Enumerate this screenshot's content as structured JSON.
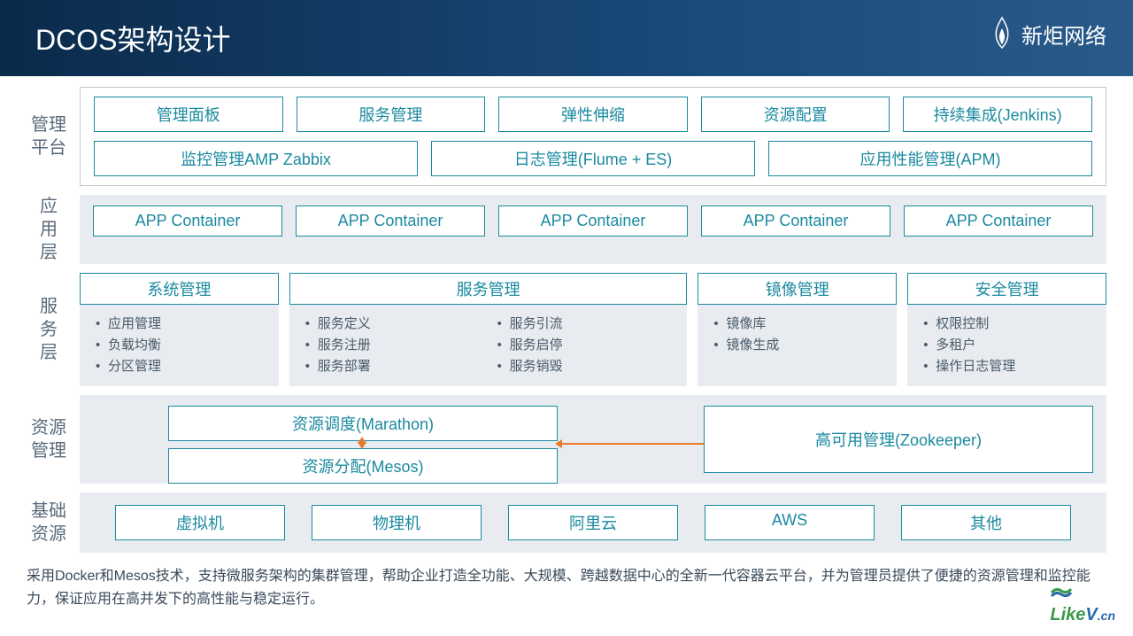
{
  "title": "DCOS架构设计",
  "brand": "新炬网络",
  "layers": {
    "mgmt": {
      "label": "管理\n平台",
      "row1": [
        "管理面板",
        "服务管理",
        "弹性伸缩",
        "资源配置",
        "持续集成(Jenkins)"
      ],
      "row2": [
        "监控管理AMP Zabbix",
        "日志管理(Flume + ES)",
        "应用性能管理(APM)"
      ]
    },
    "app": {
      "label": "应\n用\n层",
      "items": [
        "APP Container",
        "APP Container",
        "APP Container",
        "APP Container",
        "APP Container"
      ]
    },
    "service": {
      "label": "服\n务\n层",
      "groups": [
        {
          "title": "系统管理",
          "items": [
            "应用管理",
            "负载均衡",
            "分区管理"
          ],
          "span": 1
        },
        {
          "title": "服务管理",
          "items": [
            "服务定义",
            "服务注册",
            "服务部署"
          ],
          "items2": [
            "服务引流",
            "服务启停",
            "服务销毁"
          ],
          "span": 2
        },
        {
          "title": "镜像管理",
          "items": [
            "镜像库",
            "镜像生成"
          ],
          "span": 1
        },
        {
          "title": "安全管理",
          "items": [
            "权限控制",
            "多租户",
            "操作日志管理"
          ],
          "span": 1
        }
      ]
    },
    "resource": {
      "label": "资源\n管理",
      "left": [
        "资源调度(Marathon)",
        "资源分配(Mesos)"
      ],
      "right": "高可用管理(Zookeeper)"
    },
    "infra": {
      "label": "基础\n资源",
      "items": [
        "虚拟机",
        "物理机",
        "阿里云",
        "AWS",
        "其他"
      ]
    }
  },
  "footer": "采用Docker和Mesos技术，支持微服务架构的集群管理，帮助企业打造全功能、大规模、跨越数据中心的全新一代容器云平台，并为管理员提供了便捷的资源管理和监控能力，保证应用在高并发下的高性能与稳定运行。",
  "watermark": {
    "part1": "Like",
    "part2": "V",
    "suffix": ".cn"
  }
}
